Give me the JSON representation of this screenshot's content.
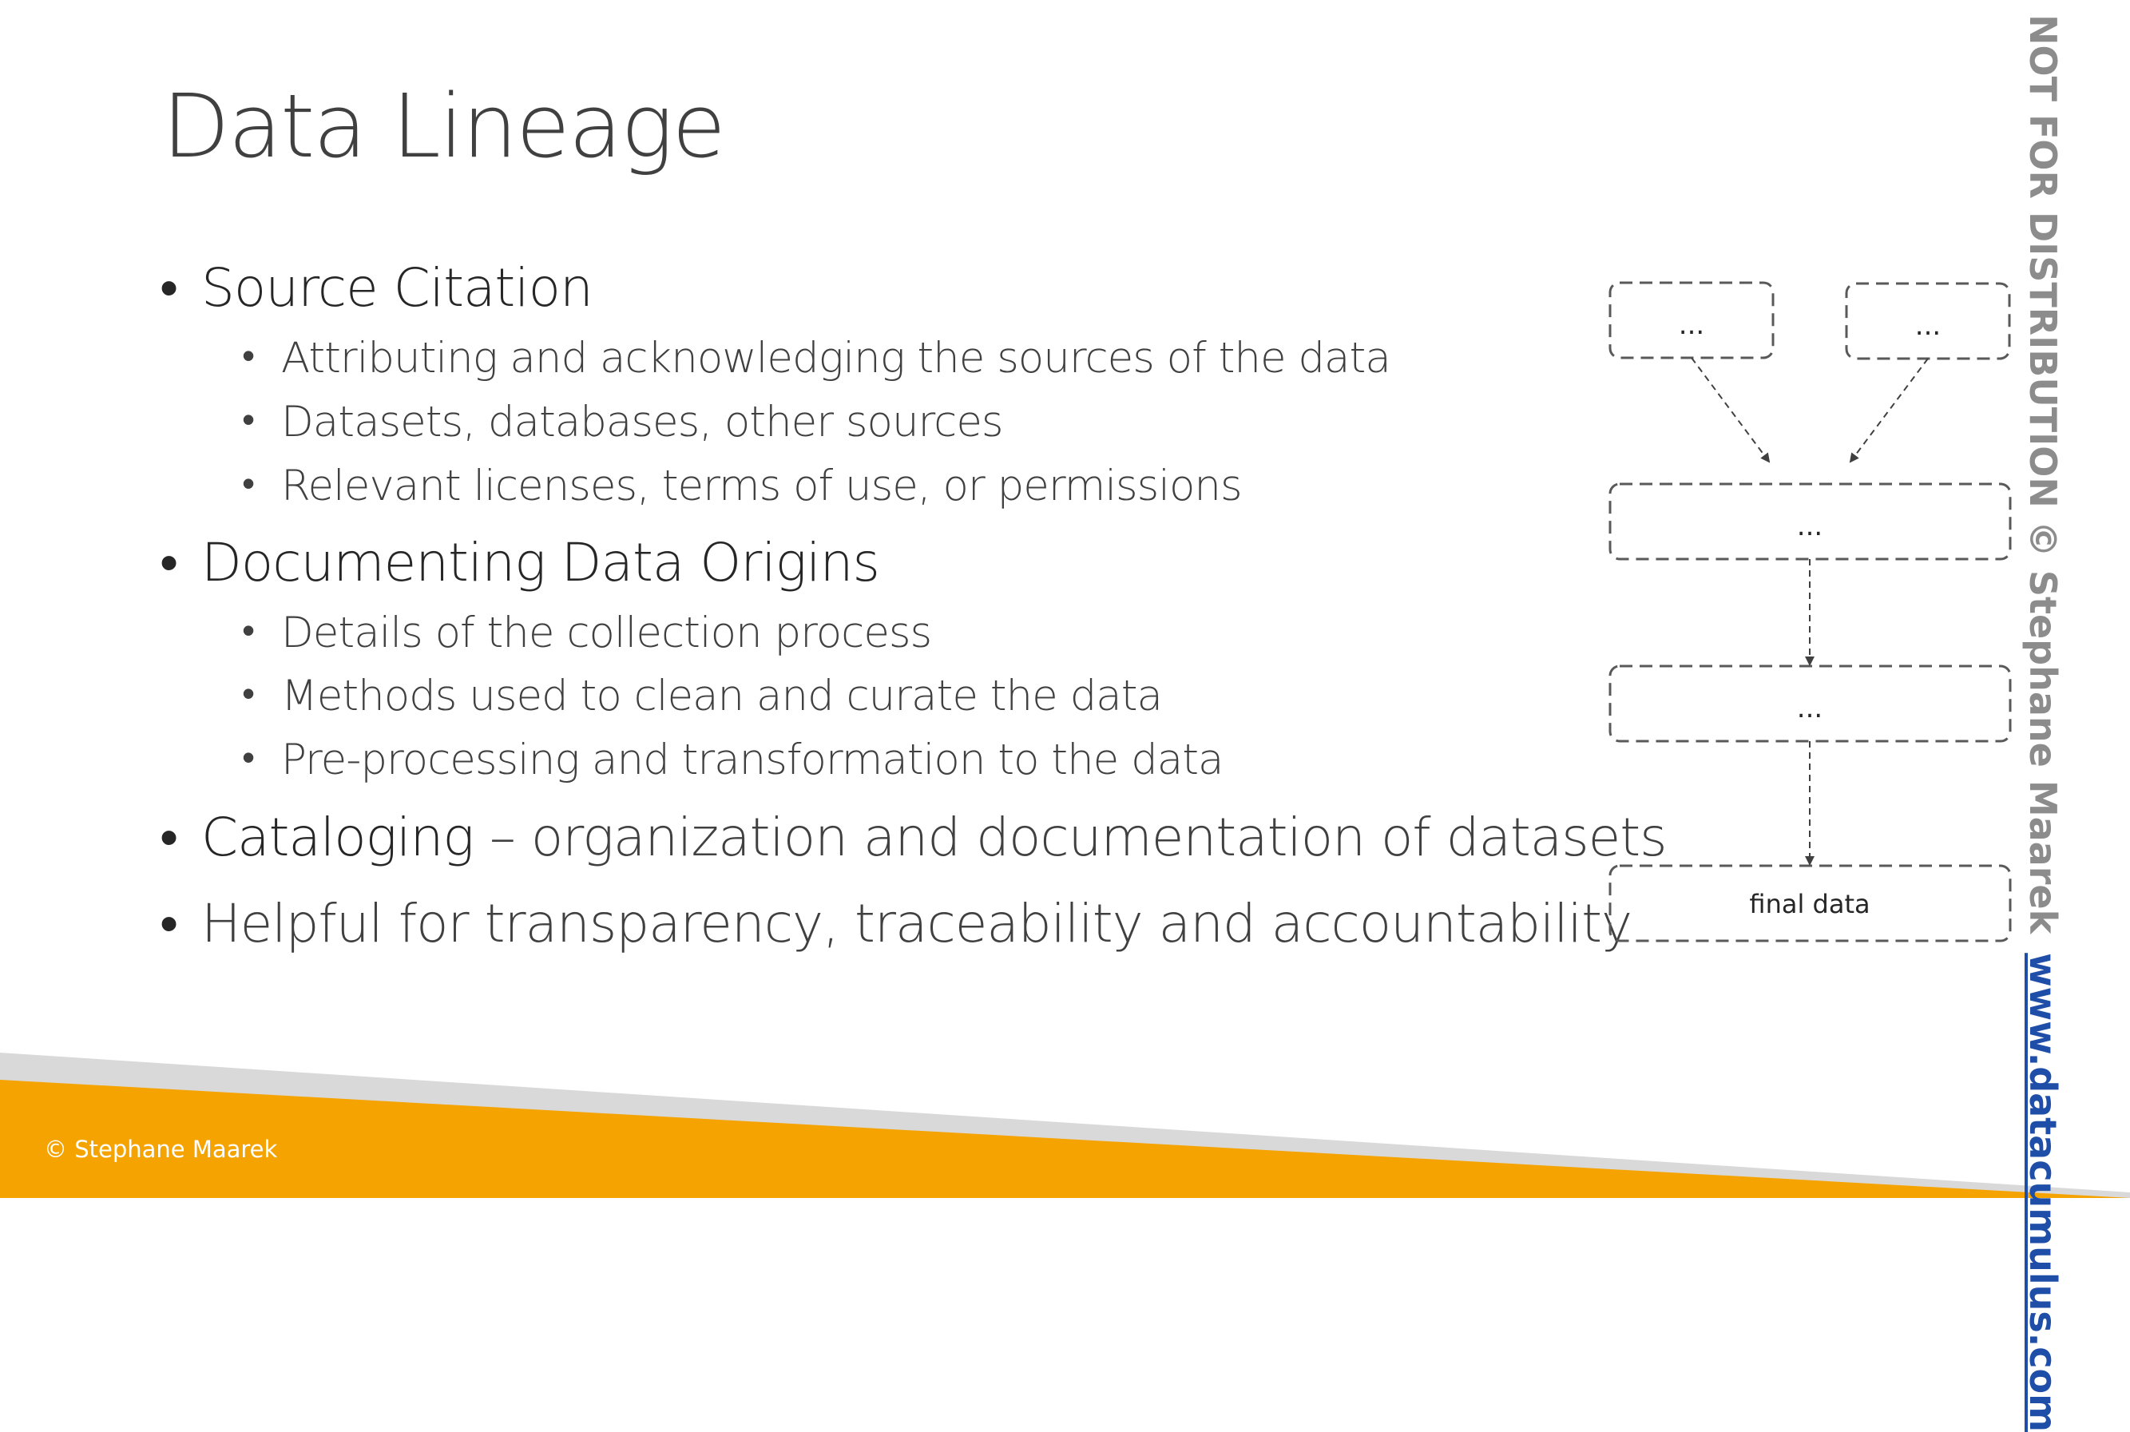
{
  "slide": {
    "title": "Data Lineage"
  },
  "bullets": [
    {
      "level": 1,
      "text": "Source Citation",
      "rest": ""
    },
    {
      "level": 2,
      "text": "Attributing and acknowledging the sources of the data"
    },
    {
      "level": 2,
      "text": "Datasets, databases, other sources"
    },
    {
      "level": 2,
      "text": "Relevant licenses, terms of use, or permissions"
    },
    {
      "level": 1,
      "text": "Documenting Data Origins",
      "rest": ""
    },
    {
      "level": 2,
      "text": "Details of the collection process"
    },
    {
      "level": 2,
      "text": "Methods used to clean and curate the data"
    },
    {
      "level": 2,
      "text": "Pre-processing and transformation to the data"
    },
    {
      "level": 1,
      "text": "Cataloging",
      "rest": " – organization and documentation of datasets"
    },
    {
      "level": 1,
      "text": "Helpful for transparency, traceability and accountability",
      "rest": ""
    }
  ],
  "diagram": {
    "nodes": [
      "...",
      "...",
      "...",
      "...",
      "final data"
    ]
  },
  "watermark": {
    "text": "NOT FOR DISTRIBUTION © Stephane Maarek",
    "link": "www.datacumulus.com"
  },
  "footer": {
    "copyright": "© Stephane Maarek"
  },
  "colors": {
    "accent_orange": "#F5A300",
    "band_grey": "#D9D9D9",
    "link_blue": "#1F4EA8"
  }
}
